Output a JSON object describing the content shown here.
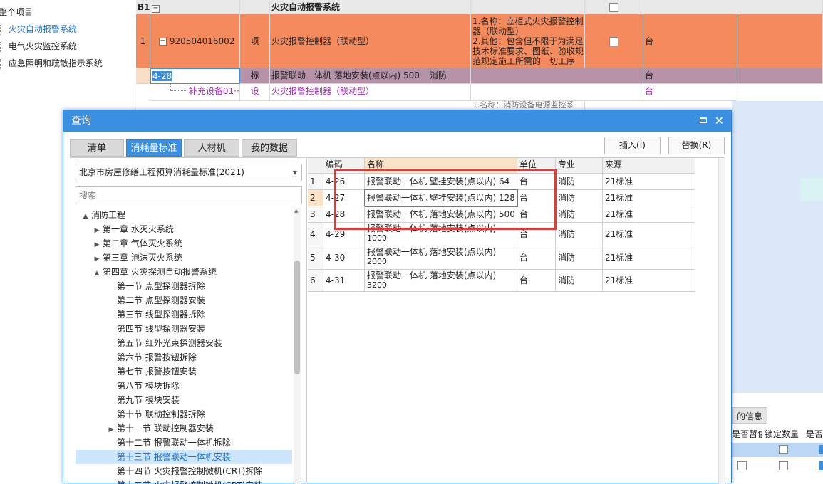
{
  "left_tree": {
    "items": [
      {
        "label": "整个项目",
        "selected": false
      },
      {
        "label": "火灾自动报警系统",
        "selected": true
      },
      {
        "label": "电气火灾监控系统",
        "selected": false
      },
      {
        "label": "应急照明和疏散指示系统",
        "selected": false
      }
    ]
  },
  "grid": {
    "section_row": {
      "id": "B1",
      "toggle": "−",
      "name": "火灾自动报警系统"
    },
    "row1": {
      "num": "1",
      "toggle": "−",
      "code": "920504016002",
      "type": "项",
      "name": "火灾报警控制器（联动型）",
      "desc1": "1.名称：立柜式火灾报警控制",
      "desc2": "器（联动型）",
      "desc3": "2.其他：包含但不限于为满足",
      "desc4": "技术标准要求、图纸、验收规",
      "desc5": "范规定施工所需的一切工序",
      "unit": "台"
    },
    "row2": {
      "code": "4-28",
      "type": "标",
      "name": "报警联动一体机 落地安装(点以内) 500",
      "major": "消防",
      "unit": "台"
    },
    "row3": {
      "code": "补充设备01···",
      "type": "设",
      "name": "火灾报警控制器（联动型）",
      "unit": "台"
    },
    "row4": {
      "desc": "1.名称：消防设备电源监控系"
    },
    "bottom_tab": "的信息",
    "bottom_headers": [
      "是否暂估",
      "锁定数量",
      "是否"
    ]
  },
  "dialog": {
    "title": "查询",
    "tabs": [
      "清单",
      "消耗量标准",
      "人材机",
      "我的数据"
    ],
    "active_tab": 1,
    "insert_label": "插入(I)",
    "replace_label": "替换(R)",
    "standard_select": "北京市房屋修缮工程预算消耗量标准(2021)",
    "search_placeholder": "搜索",
    "tree": [
      {
        "label": "消防工程",
        "level": 0,
        "arrow": "▲"
      },
      {
        "label": "第一章 水灭火系统",
        "level": 1,
        "arrow": "▶"
      },
      {
        "label": "第二章 气体灭火系统",
        "level": 1,
        "arrow": "▶"
      },
      {
        "label": "第三章 泡沫灭火系统",
        "level": 1,
        "arrow": "▶"
      },
      {
        "label": "第四章 火灾探测自动报警系统",
        "level": 1,
        "arrow": "▲"
      },
      {
        "label": "第一节 点型探测器拆除",
        "level": 2,
        "arrow": ""
      },
      {
        "label": "第二节 点型探测器安装",
        "level": 2,
        "arrow": ""
      },
      {
        "label": "第三节 线型探测器拆除",
        "level": 2,
        "arrow": ""
      },
      {
        "label": "第四节 线型探测器安装",
        "level": 2,
        "arrow": ""
      },
      {
        "label": "第五节 红外光束探测器安装",
        "level": 2,
        "arrow": ""
      },
      {
        "label": "第六节 报警按钮拆除",
        "level": 2,
        "arrow": ""
      },
      {
        "label": "第七节 报警按钮安装",
        "level": 2,
        "arrow": ""
      },
      {
        "label": "第八节 模块拆除",
        "level": 2,
        "arrow": ""
      },
      {
        "label": "第九节 模块安装",
        "level": 2,
        "arrow": ""
      },
      {
        "label": "第十节 联动控制器拆除",
        "level": 2,
        "arrow": ""
      },
      {
        "label": "第十一节 联动控制器安装",
        "level": 2,
        "arrow": "▶"
      },
      {
        "label": "第十二节 报警联动一体机拆除",
        "level": 2,
        "arrow": ""
      },
      {
        "label": "第十三节 报警联动一体机安装",
        "level": 2,
        "arrow": "",
        "selected": true
      },
      {
        "label": "第十四节 火灾报警控制微机(CRT)拆除",
        "level": 2,
        "arrow": ""
      },
      {
        "label": "第十五节 火灾报警控制微机(CRT)安装",
        "level": 2,
        "arrow": ""
      }
    ],
    "table": {
      "headers": [
        "编码",
        "名称",
        "单位",
        "专业",
        "来源"
      ],
      "rows": [
        {
          "idx": "1",
          "code": "4-26",
          "name1": "报警联动一体机 壁挂安装(点以内) 64",
          "name2": "",
          "unit": "台",
          "major": "消防",
          "source": "21标准"
        },
        {
          "idx": "2",
          "code": "4-27",
          "name1": "报警联动一体机 壁挂安装(点以内) 128",
          "name2": "",
          "unit": "台",
          "major": "消防",
          "source": "21标准"
        },
        {
          "idx": "3",
          "code": "4-28",
          "name1": "报警联动一体机 落地安装(点以内) 500",
          "name2": "",
          "unit": "台",
          "major": "消防",
          "source": "21标准"
        },
        {
          "idx": "4",
          "code": "4-29",
          "name1": "报警联动一体机 落地安装(点以内)",
          "name2": "1000",
          "unit": "台",
          "major": "消防",
          "source": "21标准"
        },
        {
          "idx": "5",
          "code": "4-30",
          "name1": "报警联动一体机 落地安装(点以内)",
          "name2": "2000",
          "unit": "台",
          "major": "消防",
          "source": "21标准"
        },
        {
          "idx": "6",
          "code": "4-31",
          "name1": "报警联动一体机 落地安装(点以内)",
          "name2": "3200",
          "unit": "台",
          "major": "消防",
          "source": "21标准"
        }
      ]
    }
  },
  "colors": {
    "accent": "#3a8fe0",
    "row_orange": "#f58b5c",
    "row_purple": "#b592a8",
    "highlight_box": "#e53935"
  }
}
